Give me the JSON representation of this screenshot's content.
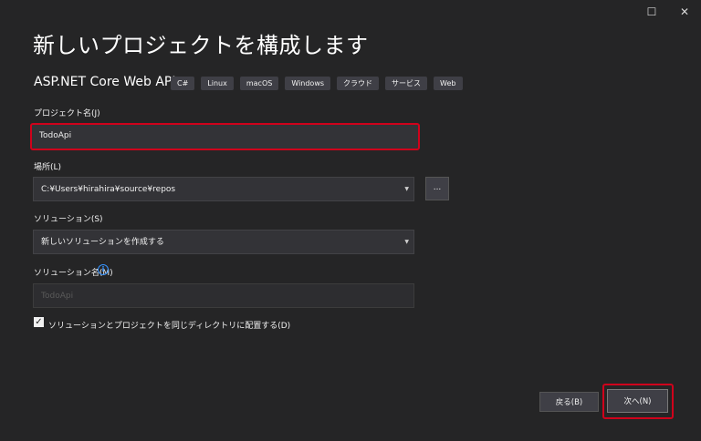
{
  "window": {
    "maximize_glyph": "☐",
    "close_glyph": "✕"
  },
  "header": {
    "title": "新しいプロジェクトを構成します",
    "template_name": "ASP.NET Core Web API",
    "tags": [
      "C#",
      "Linux",
      "macOS",
      "Windows",
      "クラウド",
      "サービス",
      "Web"
    ]
  },
  "form": {
    "project_name_label": "プロジェクト名(J)",
    "project_name_value": "TodoApi",
    "location_label": "場所(L)",
    "location_value": "C:¥Users¥hirahira¥source¥repos",
    "browse_label": "...",
    "solution_label": "ソリューション(S)",
    "solution_value": "新しいソリューションを作成する",
    "solution_name_label": "ソリューション名(M)",
    "solution_name_value": "TodoApi",
    "info_glyph": "i",
    "same_dir_label": "ソリューションとプロジェクトを同じディレクトリに配置する(D)",
    "same_dir_checked": true,
    "checkmark": "✓"
  },
  "footer": {
    "back_label": "戻る(B)",
    "next_label": "次へ(N)"
  },
  "colors": {
    "background": "#252526",
    "highlight": "#d0021b",
    "info_blue": "#3794ff"
  }
}
